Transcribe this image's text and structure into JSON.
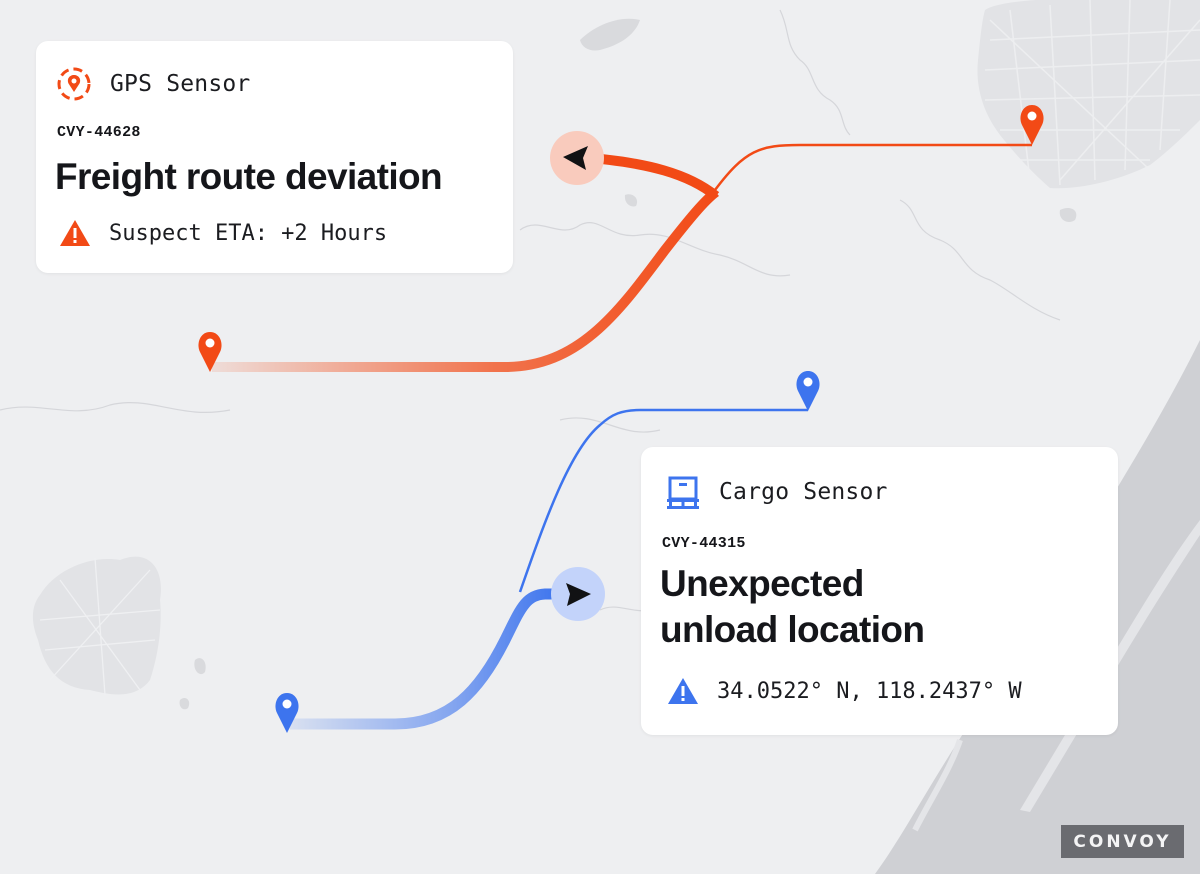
{
  "colors": {
    "map_land": "#eeeff1",
    "map_water": "#cfd0d4",
    "map_urban": "#e2e3e6",
    "deviation_route": "#f24a16",
    "deviation_halo": "#f9cbbd",
    "cargo_route": "#3d74ee",
    "cargo_halo": "#c3d3fa",
    "card_background": "#ffffff",
    "text_primary": "#15161a",
    "brand_badge": "#6a6b70"
  },
  "alerts": [
    {
      "sensor_icon": "location-pin-target-icon",
      "sensor_label": "GPS Sensor",
      "shipment_id": "CVY-44628",
      "title": "Freight route deviation",
      "warning_icon": "warning-triangle-icon",
      "detail": "Suspect ETA: +2 Hours",
      "accent": "#f24a16"
    },
    {
      "sensor_icon": "cargo-pallet-icon",
      "sensor_label": "Cargo Sensor",
      "shipment_id": "CVY-44315",
      "title_line1": "Unexpected",
      "title_line2": "unload location",
      "warning_icon": "warning-triangle-icon",
      "detail": "34.0522° N, 118.2437° W",
      "accent": "#3d74ee"
    }
  ],
  "map": {
    "routes": [
      {
        "name": "freight-route",
        "status": "deviation",
        "heading_marker": "navigation-arrow-left-icon"
      },
      {
        "name": "cargo-route",
        "status": "unexpected-stop",
        "heading_marker": "navigation-arrow-right-icon"
      }
    ],
    "markers": [
      "map-pin-icon",
      "map-pin-icon",
      "map-pin-icon",
      "map-pin-icon"
    ]
  },
  "brand": {
    "logo_text": "CONVOY"
  }
}
